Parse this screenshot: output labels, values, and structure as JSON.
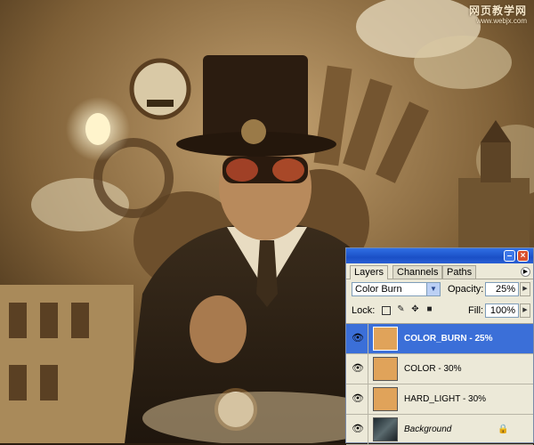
{
  "watermark": {
    "site_name": "网页教学网",
    "url": "www.webjx.com"
  },
  "panel": {
    "tabs": [
      "Layers",
      "Channels",
      "Paths"
    ],
    "blend_mode": "Color Burn",
    "opacity_label": "Opacity:",
    "opacity_value": "25%",
    "lock_label": "Lock:",
    "fill_label": "Fill:",
    "fill_value": "100%",
    "layers": [
      {
        "name": "COLOR_BURN - 25%",
        "selected": true,
        "thumb_color": "#e0a35a"
      },
      {
        "name": "COLOR - 30%",
        "selected": false,
        "thumb_color": "#e0a35a"
      },
      {
        "name": "HARD_LIGHT - 30%",
        "selected": false,
        "thumb_color": "#e0a35a"
      },
      {
        "name": "Background",
        "selected": false,
        "locked": true
      }
    ]
  },
  "colors": {
    "accent": "#3b6fd8",
    "titlebar": "#2460d6",
    "sepia": "#8a6a3a"
  }
}
